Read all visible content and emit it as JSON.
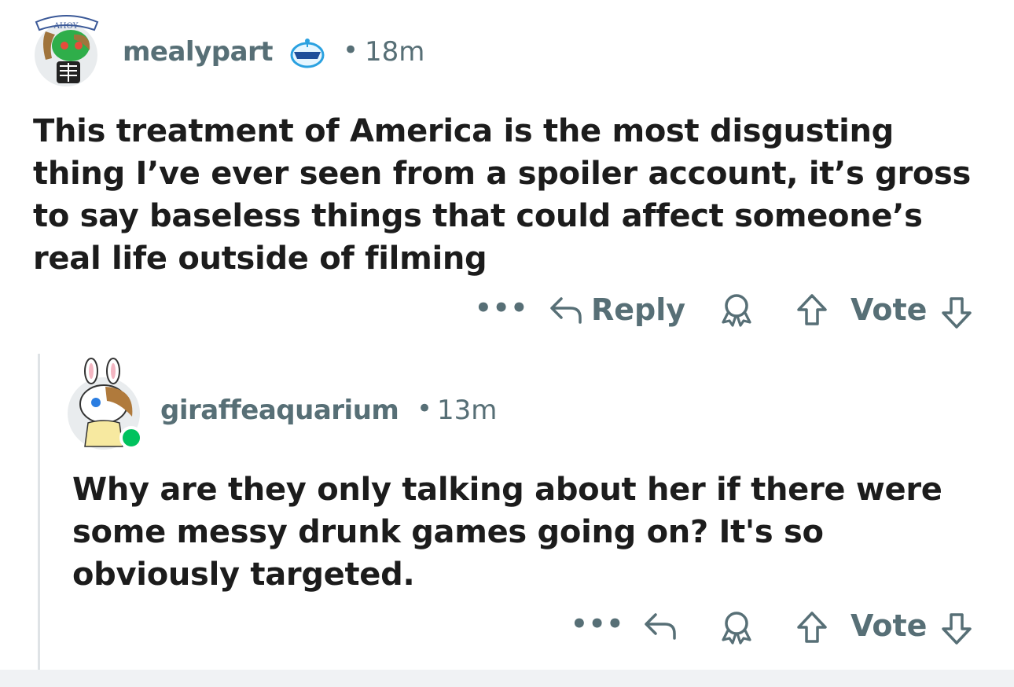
{
  "colors": {
    "meta_text": "#576f76",
    "body_text": "#1c1c1c",
    "online": "#00c25e",
    "thread_line": "#dfe3e6"
  },
  "comment": {
    "avatar_icon": "snoo-avatar-skeleton-icon",
    "avatar_hat_text": "AHOY",
    "username": "mealypart",
    "flair_icon": "snoo-sunglasses-icon",
    "separator": "•",
    "time": "18m",
    "body": "This treatment of America is the most disgusting thing I’ve ever seen from a spoiler account, it’s gross to say baseless things that could affect someone’s real life outside of filming",
    "actions": {
      "more": "•••",
      "reply": "Reply",
      "vote": "Vote"
    }
  },
  "reply": {
    "avatar_icon": "snoo-avatar-bunny-icon",
    "username": "giraffeaquarium",
    "separator": "•",
    "time": "13m",
    "body": "Why are they only talking about her if there were some messy drunk games going on? It's so obviously targeted.",
    "actions": {
      "more": "•••",
      "vote": "Vote"
    }
  }
}
